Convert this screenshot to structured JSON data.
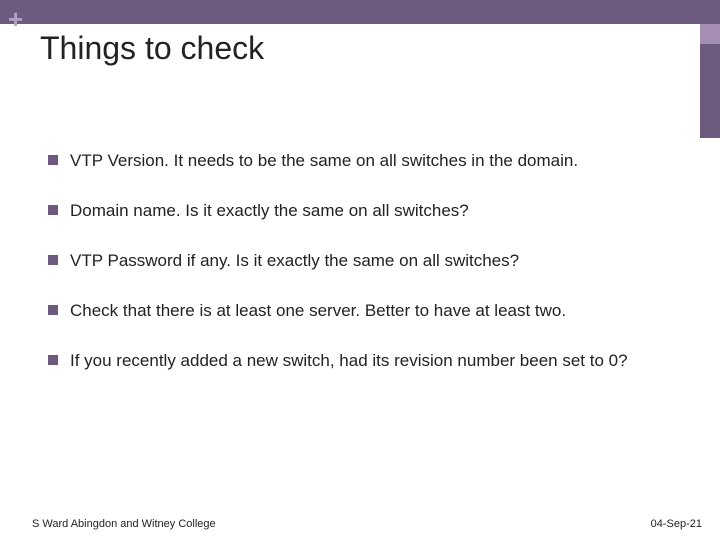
{
  "decor": {
    "plus": "+"
  },
  "title": "Things to check",
  "bullets": [
    "VTP Version. It needs to be the same on all switches in the domain.",
    "Domain name. Is it exactly the same on all switches?",
    "VTP Password if any. Is it exactly the same on all switches?",
    "Check that there is at least one server. Better to have at least two.",
    "If you recently added a new switch, had its revision number been set to 0?"
  ],
  "footer": {
    "left": "S Ward  Abingdon and Witney College",
    "right": "04-Sep-21"
  },
  "colors": {
    "primary": "#6e5a7f",
    "accent": "#a58fb3"
  }
}
